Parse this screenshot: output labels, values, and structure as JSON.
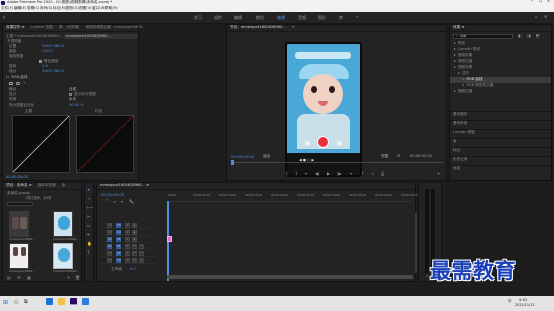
{
  "app": {
    "title": "Adobe Premiere Pro 2020 - D:\\视频\\\\视频剪辑\\未命名.prproj *"
  },
  "menu": [
    "文件(F)",
    "编辑(E)",
    "剪辑(C)",
    "序列(S)",
    "标记(M)",
    "图形(G)",
    "视图(V)",
    "窗口(W)",
    "帮助(H)"
  ],
  "workspaces": [
    "学习",
    "组件",
    "编辑",
    "颜色",
    "效果",
    "音频",
    "图形",
    "库"
  ],
  "active_workspace": "效果",
  "effect_controls": {
    "tabs": [
      "效果控件 ≡",
      "Lumetri 范围",
      "源：(无剪辑)",
      "音频剪辑混合器：mmexport1600..."
    ],
    "header_clip": "主要 * mmexport1600628960...",
    "header_seq": "mmexport1600628960...",
    "props": [
      {
        "name": "不透明度"
      },
      {
        "name": "位置",
        "value": "540.0 960.0"
      },
      {
        "name": "缩放",
        "value": "100.0"
      },
      {
        "name": "缩放宽度",
        "value": ""
      },
      {
        "name": "等比缩放",
        "checked": true
      },
      {
        "name": "旋转",
        "value": "0.0"
      },
      {
        "name": "锚点",
        "value": "540.0 960.0"
      }
    ],
    "rgb_section": "RGB 曲线",
    "channel_label": "通道",
    "channel_value": "合成",
    "output_label": "输出",
    "output_value": "合成",
    "layout_label": "布局",
    "layout_value": "水平",
    "display_label": "显示",
    "display_mask": "显示拆分视图",
    "percent_label": "拆分视图百分比",
    "percent_value": "50.00 %",
    "main_label": "主要",
    "red_label": "红色",
    "timecode": "00:00:00:00"
  },
  "program": {
    "tabs": [
      "节目：mmexport1600628960...",
      "≡"
    ],
    "timecode": "00:00:00:00",
    "fit": "适合",
    "quality": "完整",
    "end_time": "00:00:02:10",
    "phone_date": "2020/09/21 10:52"
  },
  "effects_panel": {
    "title": "效果 ≡",
    "search_value": "rgb",
    "items": [
      {
        "label": "预设",
        "indent": 1
      },
      {
        "label": "Lumetri 预设",
        "indent": 1
      },
      {
        "label": "音频效果",
        "indent": 1
      },
      {
        "label": "音频过渡",
        "indent": 1
      },
      {
        "label": "视频效果",
        "indent": 1
      },
      {
        "label": "过时",
        "indent": 2
      },
      {
        "label": "RGB 曲线",
        "indent": 3,
        "selected": true
      },
      {
        "label": "RGB 颜色校正器",
        "indent": 3
      },
      {
        "label": "视频过渡",
        "indent": 1
      }
    ],
    "side_items": [
      "基本图形",
      "基本声音",
      "Lumetri 颜色",
      "库",
      "标记",
      "历史记录",
      "信息"
    ]
  },
  "project": {
    "tabs": [
      "项目：未命名 ≡",
      "媒体浏览器",
      "库"
    ],
    "file": "未命名.prproj",
    "count": "1项已选择，共4项",
    "thumbs": [
      {
        "label": "mmexport1600...",
        "duration": "3:10"
      },
      {
        "label": "mmexport1600...",
        "duration": "2:10"
      },
      {
        "label": "mmexport1600...",
        "duration": "4:05"
      },
      {
        "label": "mmexport1600...",
        "duration": "2:10"
      }
    ]
  },
  "timeline": {
    "tab": "mmexport1600628960...  ≡",
    "timecode": "00:00:00:00",
    "ruler": [
      ":00:00",
      "00:00:05:00",
      "00:00:10:00",
      "00:00:15:00",
      "00:00:20:00",
      "00:00:25:00",
      "00:00:30:00",
      "00:00:35:00",
      "00:00:40:00",
      "00:00:45:00"
    ],
    "tracks": [
      "V3",
      "V2",
      "V1",
      "A1",
      "A2",
      "A3"
    ],
    "master": "主声道",
    "master_value": "0.0"
  },
  "taskbar": {
    "time": "9:52",
    "date": "2021/11/12",
    "lang": "中"
  },
  "watermark": "最需教育"
}
